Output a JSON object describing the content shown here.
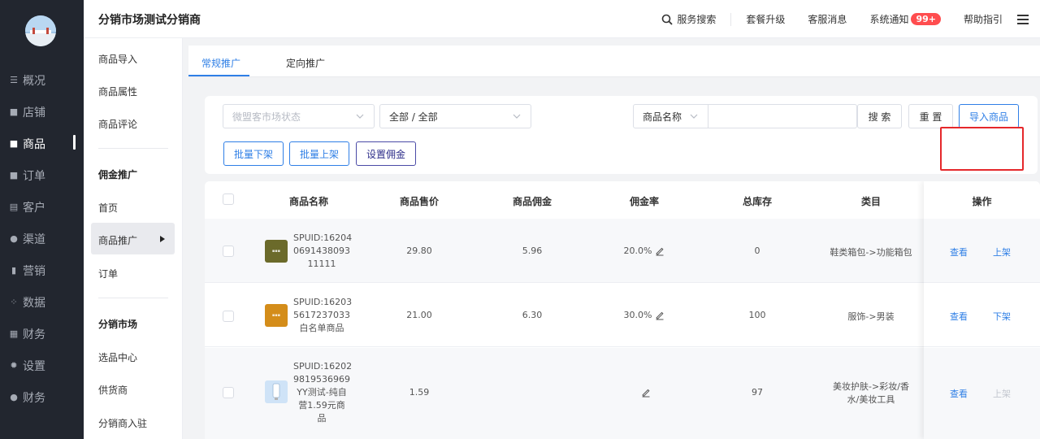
{
  "header": {
    "title": "分销市场测试分销商",
    "search_label": "服务搜索",
    "links": [
      "套餐升级",
      "客服消息"
    ],
    "notice_label": "系统通知",
    "notice_badge": "99+",
    "help_label": "帮助指引"
  },
  "sidebar": {
    "items": [
      {
        "label": "概况",
        "icon": "overview-icon"
      },
      {
        "label": "店铺",
        "icon": "store-icon"
      },
      {
        "label": "商品",
        "icon": "goods-icon",
        "active": true
      },
      {
        "label": "订单",
        "icon": "order-icon"
      },
      {
        "label": "客户",
        "icon": "customer-icon"
      },
      {
        "label": "渠道",
        "icon": "channel-icon"
      },
      {
        "label": "营销",
        "icon": "marketing-icon"
      },
      {
        "label": "数据",
        "icon": "data-icon"
      },
      {
        "label": "财务",
        "icon": "finance-icon"
      },
      {
        "label": "设置",
        "icon": "settings-icon"
      },
      {
        "label": "财务",
        "icon": "finance-icon"
      }
    ]
  },
  "subnav": {
    "group1": [
      "商品导入",
      "商品属性",
      "商品评论"
    ],
    "group2_title": "佣金推广",
    "group2": [
      "首页",
      "商品推广",
      "订单"
    ],
    "group3_title": "分销市场",
    "group3": [
      "选品中心",
      "供货商",
      "分销商入驻"
    ]
  },
  "tabs": [
    "常规推广",
    "定向推广"
  ],
  "filters": {
    "status_placeholder": "微盟客市场状态",
    "category_value": "全部 / 全部",
    "search_field_value": "商品名称",
    "search_button": "搜 索",
    "reset_button": "重 置",
    "import_button": "导入商品",
    "batch_off_button": "批量下架",
    "batch_on_button": "批量上架",
    "commission_button": "设置佣金"
  },
  "table": {
    "columns": [
      "商品名称",
      "商品售价",
      "商品佣金",
      "佣金率",
      "总库存",
      "类目",
      "操作"
    ],
    "rows": [
      {
        "name_lines": [
          "SPUID:16204",
          "0691438093",
          "11111"
        ],
        "price": "29.80",
        "commission": "5.96",
        "rate": "20.0%",
        "stock": "0",
        "category_lines": [
          "鞋类箱包->功能箱包"
        ],
        "view": "查看",
        "action": "上架",
        "action_enabled": true
      },
      {
        "name_lines": [
          "SPUID:16203",
          "5617237033",
          "白名单商品"
        ],
        "price": "21.00",
        "commission": "6.30",
        "rate": "30.0%",
        "stock": "100",
        "category_lines": [
          "服饰->男装"
        ],
        "view": "查看",
        "action": "下架",
        "action_enabled": true
      },
      {
        "name_lines": [
          "SPUID:16202",
          "9819536969",
          "YY测试-纯自",
          "营1.59元商",
          "品"
        ],
        "price": "1.59",
        "commission": "",
        "rate": "",
        "stock": "97",
        "category_lines": [
          "美妆护肤->彩妆/香",
          "水/美妆工具"
        ],
        "view": "查看",
        "action": "上架",
        "action_enabled": false
      }
    ]
  },
  "colors": {
    "sidebar_bg": "#22262f",
    "accent_blue": "#2f7fe6",
    "badge_red": "#ff4d4f",
    "highlight_red": "#e5282b"
  }
}
